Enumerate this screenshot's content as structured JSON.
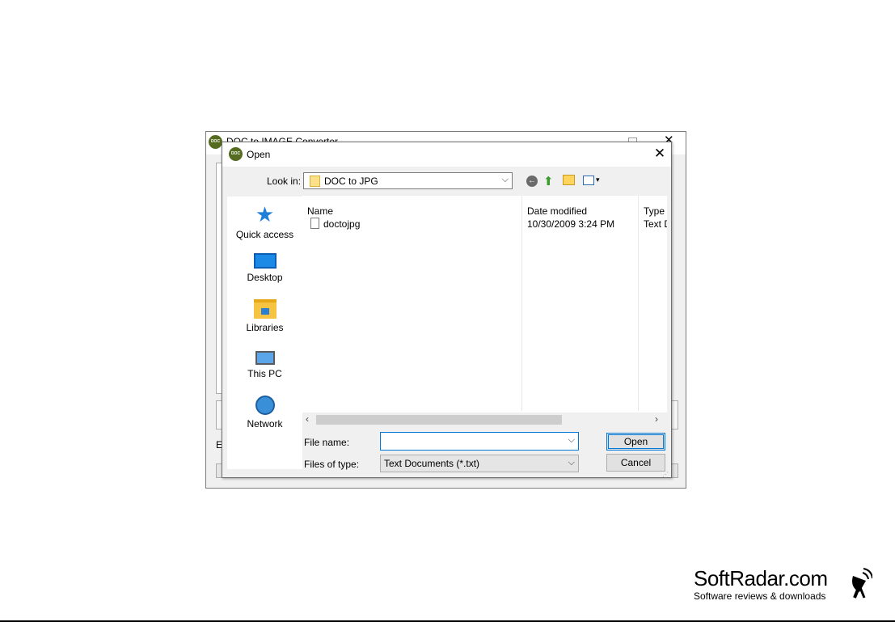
{
  "background_window": {
    "title": "DOC to IMAGE Converter",
    "logo_text": "DOC",
    "partial_label": "E"
  },
  "dialog": {
    "title": "Open",
    "logo_text": "DOC",
    "close_glyph": "✕",
    "look_in": {
      "label": "Look in:",
      "value": "DOC to JPG"
    },
    "toolbar": {
      "back_icon": "back-arrow-icon",
      "up_icon": "up-folder-icon",
      "new_folder_icon": "new-folder-icon",
      "views_icon": "view-menu-icon"
    },
    "places": [
      {
        "label": "Quick access",
        "icon": "star-icon"
      },
      {
        "label": "Desktop",
        "icon": "desktop-icon"
      },
      {
        "label": "Libraries",
        "icon": "libraries-icon"
      },
      {
        "label": "This PC",
        "icon": "computer-icon"
      },
      {
        "label": "Network",
        "icon": "network-icon"
      }
    ],
    "columns": {
      "name": "Name",
      "date_modified": "Date modified",
      "type": "Type"
    },
    "files": [
      {
        "name": "doctojpg",
        "date_modified": "10/30/2009 3:24 PM",
        "type": "Text D"
      }
    ],
    "file_name": {
      "label": "File name:",
      "value": ""
    },
    "file_type": {
      "label": "Files of type:",
      "value": "Text Documents (*.txt)"
    },
    "buttons": {
      "open": "Open",
      "cancel": "Cancel"
    }
  },
  "watermark": {
    "title": "SoftRadar.com",
    "subtitle": "Software reviews & downloads"
  },
  "colors": {
    "accent": "#0078d7",
    "dialog_bg": "#f0f0f0",
    "logo_green": "#556b1f"
  }
}
